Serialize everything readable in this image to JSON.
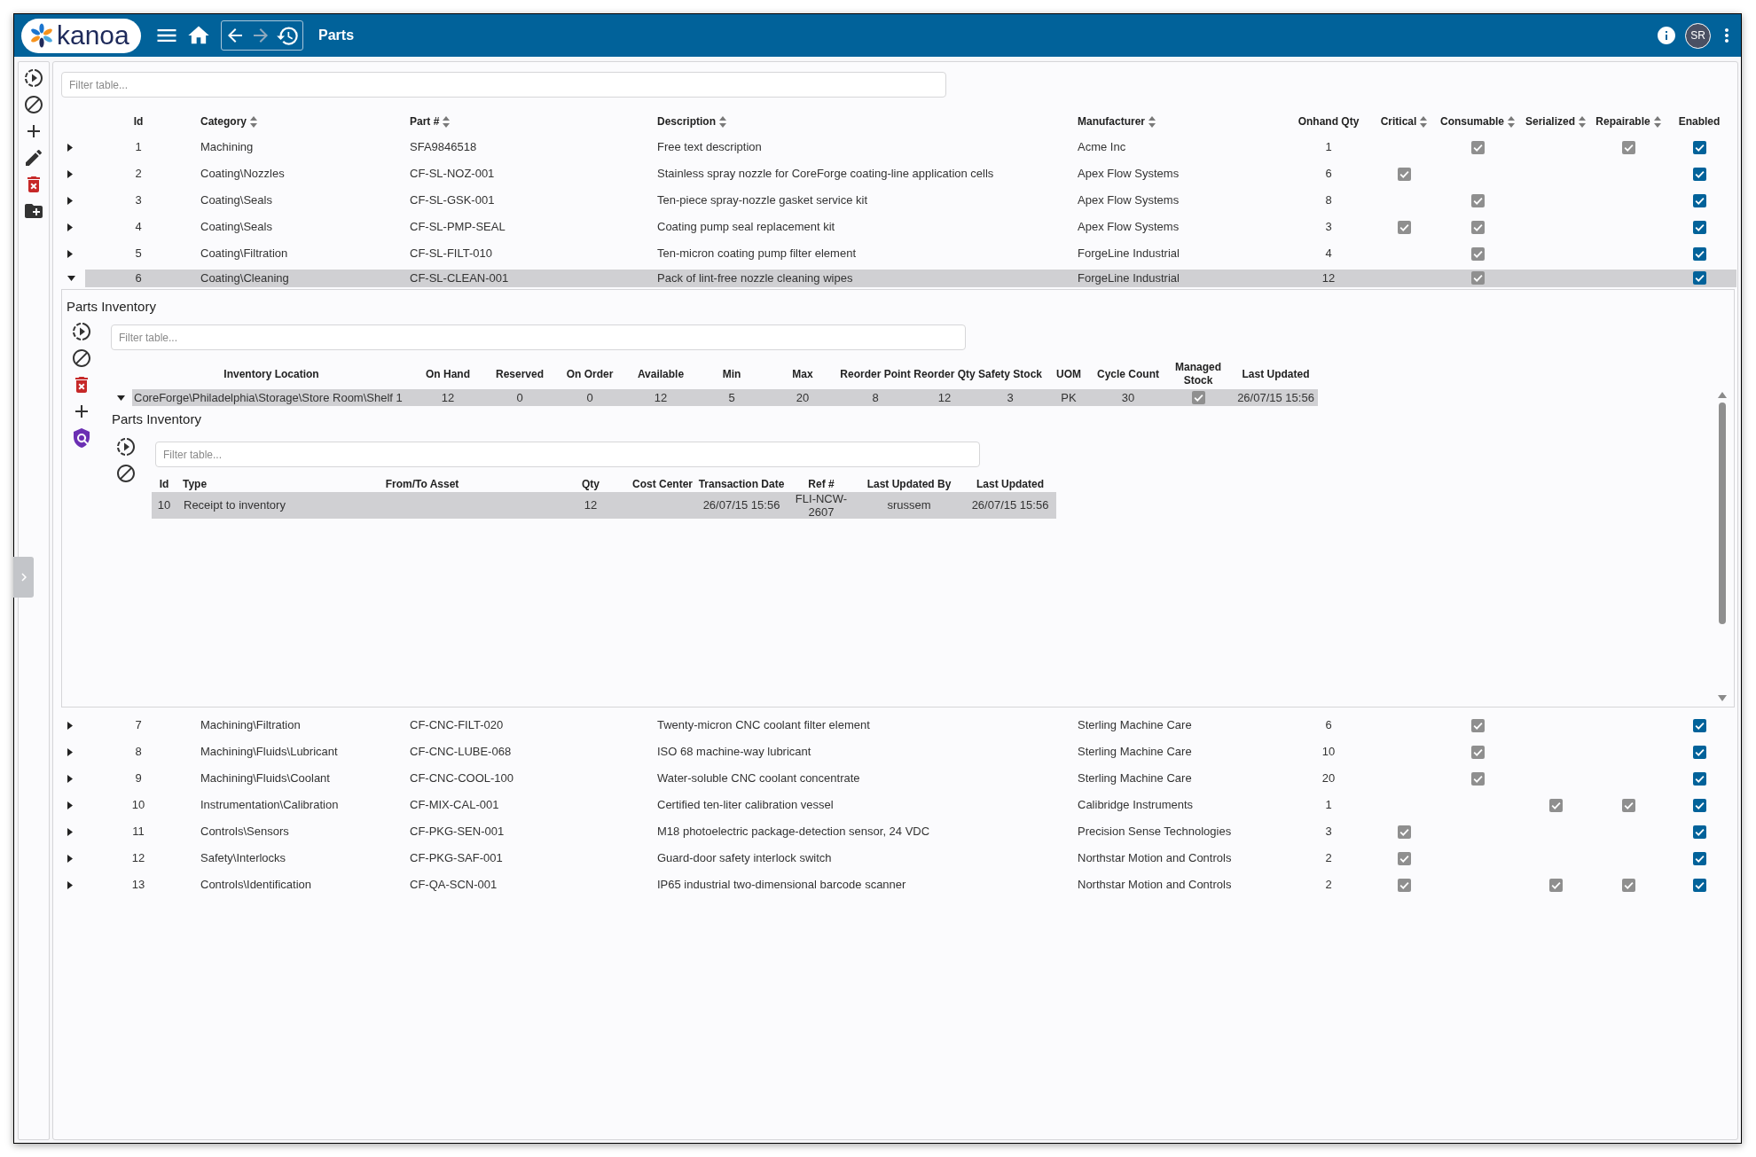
{
  "app_bar": {
    "logo_text": "kanoa",
    "navigation": {
      "back_disabled": false,
      "forward_disabled": true
    },
    "title": "Parts",
    "user_initials": "SR"
  },
  "parts_table": {
    "filter": {
      "placeholder": "Filter table..."
    },
    "columns": [
      {
        "label": "Id",
        "sortable": false
      },
      {
        "label": "Category",
        "sortable": true
      },
      {
        "label": "Part #",
        "sortable": true
      },
      {
        "label": "Description",
        "sortable": true
      },
      {
        "label": "Manufacturer",
        "sortable": true
      },
      {
        "label": "Onhand Qty",
        "sortable": false
      },
      {
        "label": "Critical",
        "sortable": true
      },
      {
        "label": "Consumable",
        "sortable": true
      },
      {
        "label": "Serialized",
        "sortable": true
      },
      {
        "label": "Repairable",
        "sortable": true
      },
      {
        "label": "Enabled",
        "sortable": false
      }
    ],
    "rows": [
      {
        "id": "1",
        "category": "Machining",
        "part_number": "SFA9846518",
        "description": "Free text description",
        "manufacturer": "Acme Inc",
        "onhand_qty": "1",
        "critical": false,
        "consumable": true,
        "serialized": false,
        "repairable": true,
        "enabled": true,
        "expanded": false,
        "selected": false
      },
      {
        "id": "2",
        "category": "Coating\\Nozzles",
        "part_number": "CF-SL-NOZ-001",
        "description": "Stainless spray nozzle for CoreForge coating-line application cells",
        "manufacturer": "Apex Flow Systems",
        "onhand_qty": "6",
        "critical": true,
        "consumable": false,
        "serialized": false,
        "repairable": false,
        "enabled": true,
        "expanded": false,
        "selected": false
      },
      {
        "id": "3",
        "category": "Coating\\Seals",
        "part_number": "CF-SL-GSK-001",
        "description": "Ten-piece spray-nozzle gasket service kit",
        "manufacturer": "Apex Flow Systems",
        "onhand_qty": "8",
        "critical": false,
        "consumable": true,
        "serialized": false,
        "repairable": false,
        "enabled": true,
        "expanded": false,
        "selected": false
      },
      {
        "id": "4",
        "category": "Coating\\Seals",
        "part_number": "CF-SL-PMP-SEAL",
        "description": "Coating pump seal replacement kit",
        "manufacturer": "Apex Flow Systems",
        "onhand_qty": "3",
        "critical": true,
        "consumable": true,
        "serialized": false,
        "repairable": false,
        "enabled": true,
        "expanded": false,
        "selected": false
      },
      {
        "id": "5",
        "category": "Coating\\Filtration",
        "part_number": "CF-SL-FILT-010",
        "description": "Ten-micron coating pump filter element",
        "manufacturer": "ForgeLine Industrial",
        "onhand_qty": "4",
        "critical": false,
        "consumable": true,
        "serialized": false,
        "repairable": false,
        "enabled": true,
        "expanded": false,
        "selected": false
      },
      {
        "id": "6",
        "category": "Coating\\Cleaning",
        "part_number": "CF-SL-CLEAN-001",
        "description": "Pack of lint-free nozzle cleaning wipes",
        "manufacturer": "ForgeLine Industrial",
        "onhand_qty": "12",
        "critical": false,
        "consumable": true,
        "serialized": false,
        "repairable": false,
        "enabled": true,
        "expanded": true,
        "selected": true,
        "detail": {
          "title": "Parts Inventory",
          "filter": {
            "placeholder": "Filter table..."
          },
          "columns": [
            "Inventory Location",
            "On Hand",
            "Reserved",
            "On Order",
            "Available",
            "Min",
            "Max",
            "Reorder Point",
            "Reorder Qty",
            "Safety Stock",
            "UOM",
            "Cycle Count",
            "Managed Stock",
            "Last Updated"
          ],
          "rows": [
            {
              "location": "CoreForge\\Philadelphia\\Storage\\Store Room\\Shelf 1",
              "on_hand": "12",
              "reserved": "0",
              "on_order": "0",
              "available": "12",
              "min": "5",
              "max": "20",
              "reorder_point": "8",
              "reorder_qty": "12",
              "safety_stock": "3",
              "uom": "PK",
              "cycle_count": "30",
              "managed_stock": true,
              "last_updated": "26/07/15 15:56",
              "expanded": true,
              "selected": true,
              "detail": {
                "title": "Parts Inventory",
                "filter": {
                  "placeholder": "Filter table..."
                },
                "columns": [
                  "Id",
                  "Type",
                  "From/To Asset",
                  "Qty",
                  "Cost Center",
                  "Transaction Date",
                  "Ref #",
                  "Last Updated By",
                  "Last Updated"
                ],
                "rows": [
                  {
                    "id": "10",
                    "type": "Receipt to inventory",
                    "qty": "12",
                    "transaction_date": "26/07/15 15:56",
                    "ref": "FLI-NCW-2607",
                    "last_updated_by": "srussem",
                    "last_updated": "26/07/15 15:56",
                    "selected": true
                  }
                ]
              }
            }
          ]
        }
      },
      {
        "id": "7",
        "category": "Machining\\Filtration",
        "part_number": "CF-CNC-FILT-020",
        "description": "Twenty-micron CNC coolant filter element",
        "manufacturer": "Sterling Machine Care",
        "onhand_qty": "6",
        "critical": false,
        "consumable": true,
        "serialized": false,
        "repairable": false,
        "enabled": true,
        "expanded": false,
        "selected": false
      },
      {
        "id": "8",
        "category": "Machining\\Fluids\\Lubricant",
        "part_number": "CF-CNC-LUBE-068",
        "description": "ISO 68 machine-way lubricant",
        "manufacturer": "Sterling Machine Care",
        "onhand_qty": "10",
        "critical": false,
        "consumable": true,
        "serialized": false,
        "repairable": false,
        "enabled": true,
        "expanded": false,
        "selected": false
      },
      {
        "id": "9",
        "category": "Machining\\Fluids\\Coolant",
        "part_number": "CF-CNC-COOL-100",
        "description": "Water-soluble CNC coolant concentrate",
        "manufacturer": "Sterling Machine Care",
        "onhand_qty": "20",
        "critical": false,
        "consumable": true,
        "serialized": false,
        "repairable": false,
        "enabled": true,
        "expanded": false,
        "selected": false
      },
      {
        "id": "10",
        "category": "Instrumentation\\Calibration",
        "part_number": "CF-MIX-CAL-001",
        "description": "Certified ten-liter calibration vessel",
        "manufacturer": "Calibridge Instruments",
        "onhand_qty": "1",
        "critical": false,
        "consumable": false,
        "serialized": true,
        "repairable": true,
        "enabled": true,
        "expanded": false,
        "selected": false
      },
      {
        "id": "11",
        "category": "Controls\\Sensors",
        "part_number": "CF-PKG-SEN-001",
        "description": "M18 photoelectric package-detection sensor, 24 VDC",
        "manufacturer": "Precision Sense Technologies",
        "onhand_qty": "3",
        "critical": true,
        "consumable": false,
        "serialized": false,
        "repairable": false,
        "enabled": true,
        "expanded": false,
        "selected": false
      },
      {
        "id": "12",
        "category": "Safety\\Interlocks",
        "part_number": "CF-PKG-SAF-001",
        "description": "Guard-door safety interlock switch",
        "manufacturer": "Northstar Motion and Controls",
        "onhand_qty": "2",
        "critical": true,
        "consumable": false,
        "serialized": false,
        "repairable": false,
        "enabled": true,
        "expanded": false,
        "selected": false
      },
      {
        "id": "13",
        "category": "Controls\\Identification",
        "part_number": "CF-QA-SCN-001",
        "description": "IP65 industrial two-dimensional barcode scanner",
        "manufacturer": "Northstar Motion and Controls",
        "onhand_qty": "2",
        "critical": true,
        "consumable": false,
        "serialized": true,
        "repairable": true,
        "enabled": true,
        "expanded": false,
        "selected": false
      }
    ]
  }
}
